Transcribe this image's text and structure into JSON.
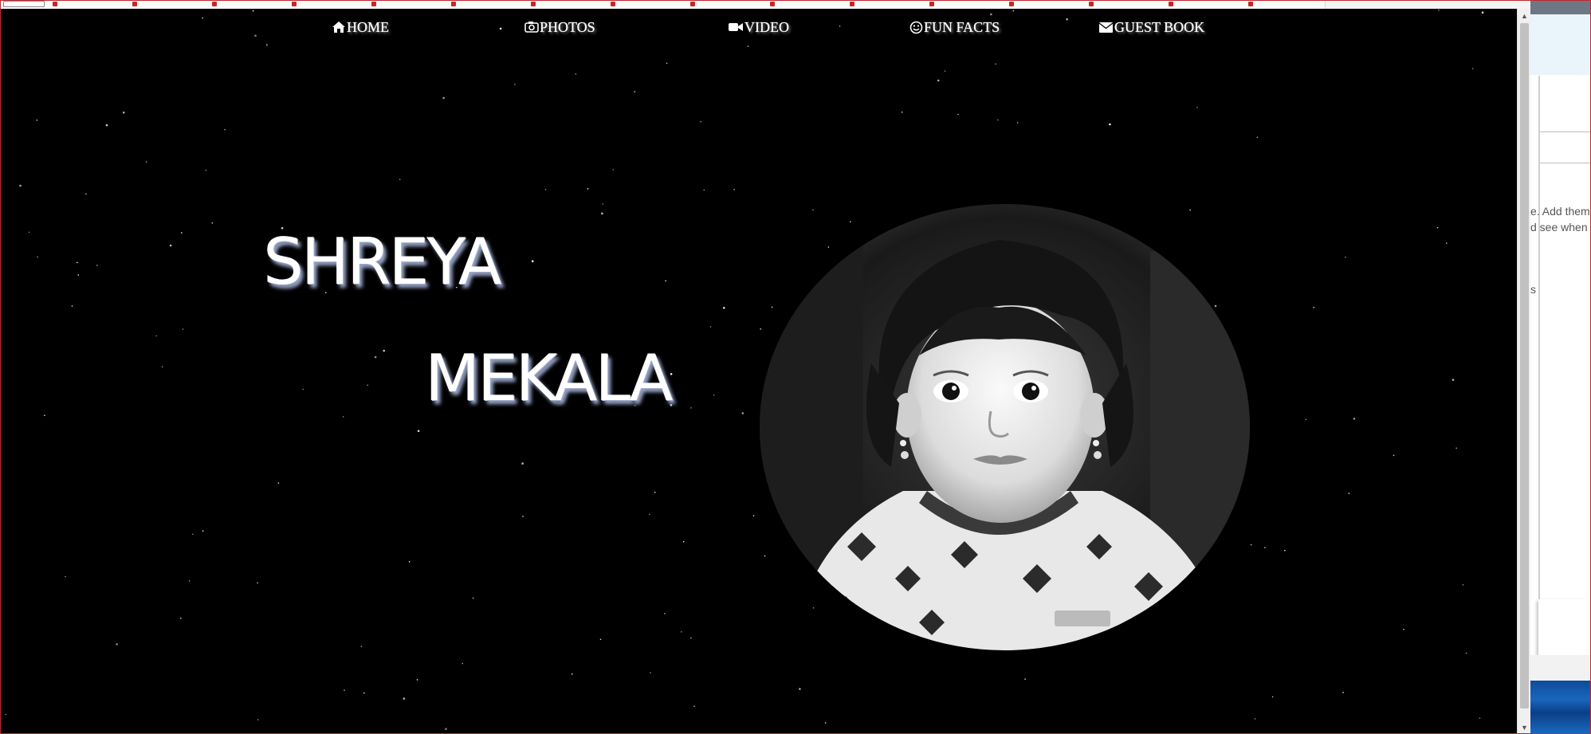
{
  "nav": {
    "items": [
      {
        "label": "HOME",
        "icon": "home-icon"
      },
      {
        "label": "PHOTOS",
        "icon": "camera-icon"
      },
      {
        "label": "VIDEO",
        "icon": "video-camera-icon"
      },
      {
        "label": "FUN FACTS",
        "icon": "smiley-icon"
      },
      {
        "label": "GUEST BOOK",
        "icon": "envelope-icon"
      }
    ]
  },
  "hero": {
    "first_name": "SHREYA",
    "last_name": "MEKALA"
  },
  "side_panel": {
    "line1": "e. Add them",
    "line2": "d see when",
    "line3": "s"
  },
  "colors": {
    "page_background": "#000000",
    "nav_text": "#ffffff",
    "name_shadow": "#9aa7c9",
    "window_border": "#c0282d"
  }
}
